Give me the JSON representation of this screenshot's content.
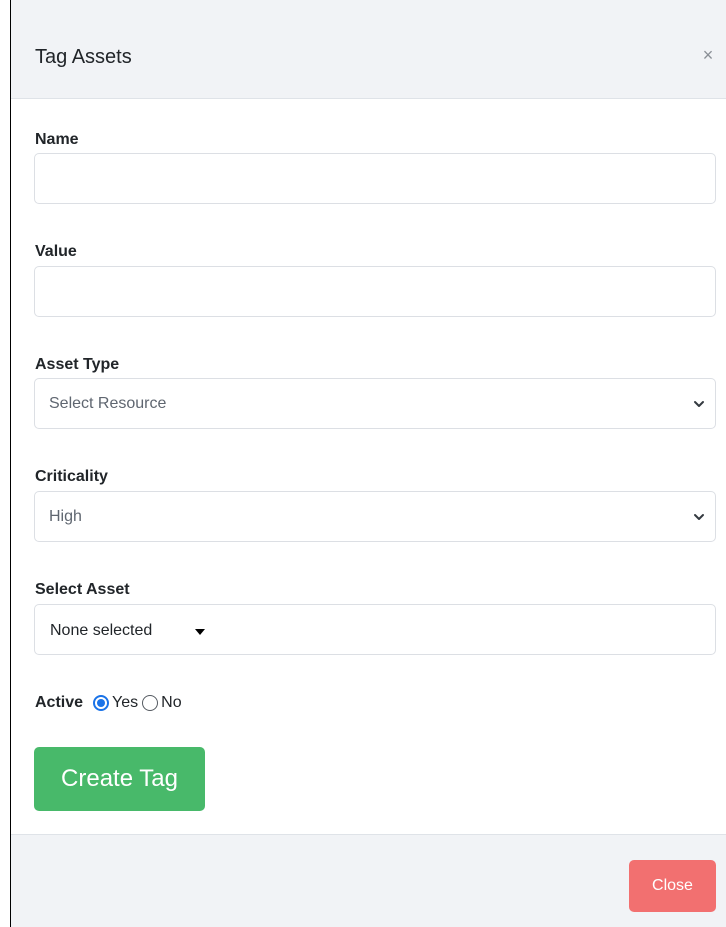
{
  "modal": {
    "title": "Tag Assets",
    "close_icon": "×"
  },
  "form": {
    "name": {
      "label": "Name",
      "value": ""
    },
    "value": {
      "label": "Value",
      "value": ""
    },
    "asset_type": {
      "label": "Asset Type",
      "selected": "Select Resource"
    },
    "criticality": {
      "label": "Criticality",
      "selected": "High"
    },
    "select_asset": {
      "label": "Select Asset",
      "selected": "None selected"
    },
    "active": {
      "label": "Active",
      "options": [
        "Yes",
        "No"
      ],
      "selected": "Yes"
    },
    "submit_label": "Create Tag"
  },
  "footer": {
    "close_label": "Close"
  },
  "icons": {
    "dialog_close": "close-icon",
    "select_chevron": "chevron-down-icon",
    "dropdown_caret": "caret-down-icon"
  },
  "colors": {
    "header_bg": "#f1f3f6",
    "create_button": "#48b96a",
    "close_button": "#f27070",
    "radio_selected": "#1a73e8"
  }
}
